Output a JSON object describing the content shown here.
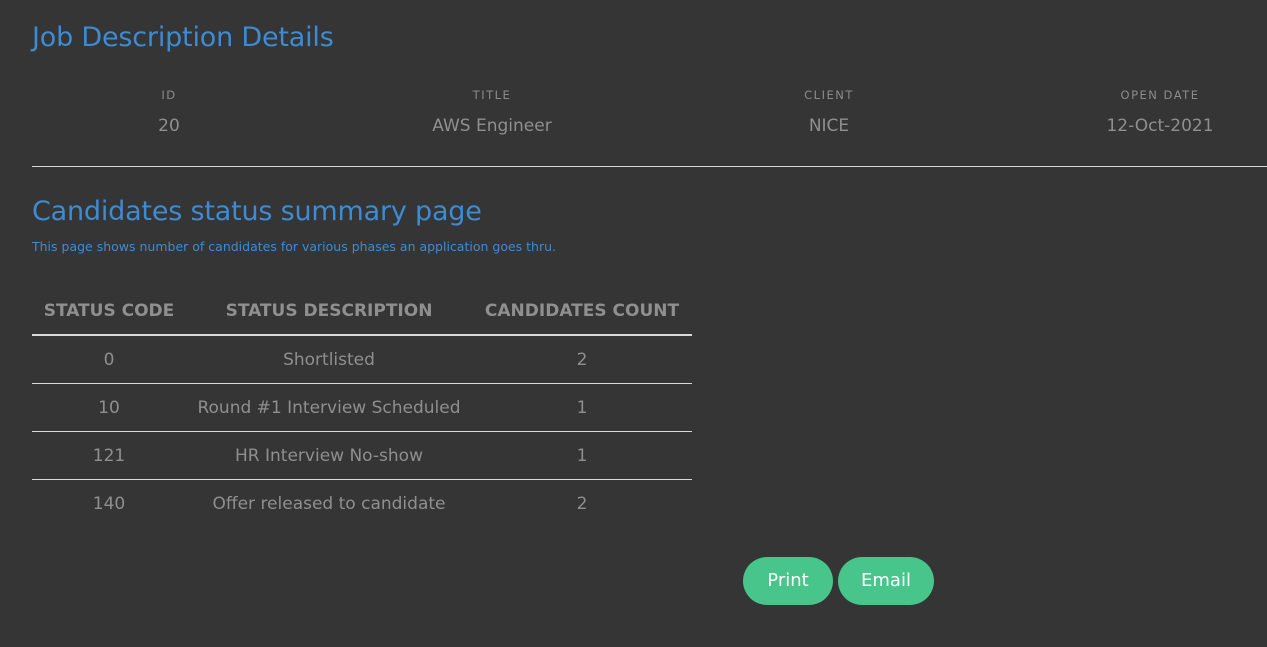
{
  "job": {
    "heading": "Job Description Details",
    "fields": [
      {
        "label": "ID",
        "value": "20"
      },
      {
        "label": "TITLE",
        "value": "AWS Engineer"
      },
      {
        "label": "CLIENT",
        "value": "NICE"
      },
      {
        "label": "OPEN DATE",
        "value": "12-Oct-2021"
      }
    ]
  },
  "summary": {
    "heading": "Candidates status summary page",
    "subtitle": "This page shows number of candidates for various phases an application goes thru."
  },
  "table": {
    "headers": [
      "STATUS CODE",
      "STATUS DESCRIPTION",
      "CANDIDATES COUNT"
    ],
    "rows": [
      [
        "0",
        "Shortlisted",
        "2"
      ],
      [
        "10",
        "Round #1 Interview Scheduled",
        "1"
      ],
      [
        "121",
        "HR Interview No-show",
        "1"
      ],
      [
        "140",
        "Offer released to candidate",
        "2"
      ]
    ]
  },
  "actions": {
    "print_label": "Print",
    "email_label": "Email"
  },
  "colors": {
    "background": "#353535",
    "heading": "#3d8bd3",
    "text": "#8f8f8f",
    "button": "#48c58a"
  }
}
